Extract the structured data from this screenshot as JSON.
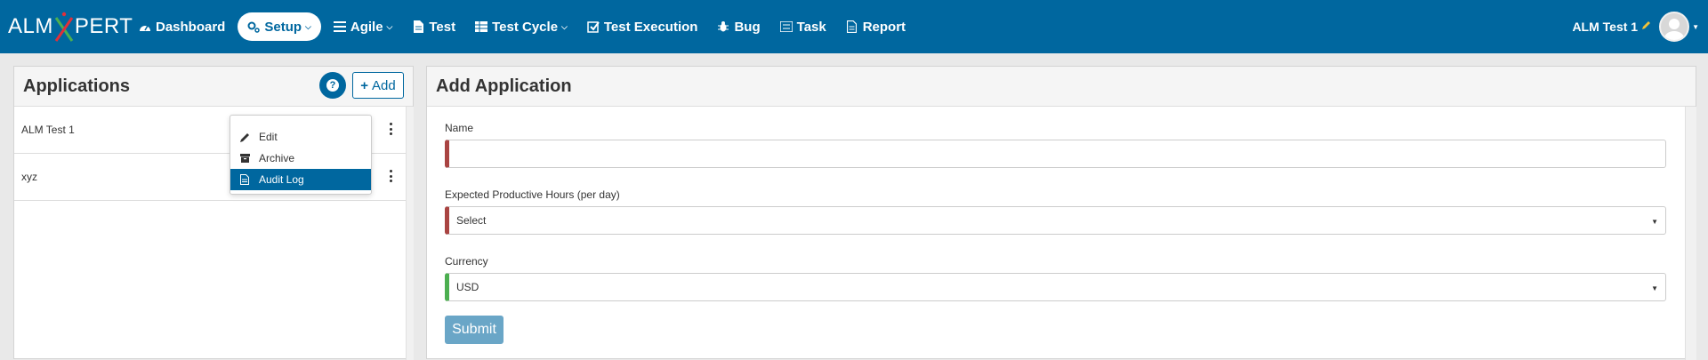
{
  "brand": {
    "logo_left": "ALM",
    "logo_right": "PERT"
  },
  "nav": {
    "items": [
      {
        "label": "Dashboard",
        "icon": "dashboard-icon"
      },
      {
        "label": "Setup",
        "icon": "cogs-icon",
        "active": true,
        "dropdown": true
      },
      {
        "label": "Agile",
        "icon": "list-icon",
        "dropdown": true
      },
      {
        "label": "Test",
        "icon": "file-icon"
      },
      {
        "label": "Test Cycle",
        "icon": "table-icon",
        "dropdown": true
      },
      {
        "label": "Test Execution",
        "icon": "check-square-icon"
      },
      {
        "label": "Bug",
        "icon": "bug-icon"
      },
      {
        "label": "Task",
        "icon": "tasks-icon"
      },
      {
        "label": "Report",
        "icon": "report-icon"
      }
    ],
    "user_name": "ALM Test 1"
  },
  "applications": {
    "title": "Applications",
    "add_label": "Add",
    "help_icon": "question-circle-icon",
    "items": [
      {
        "name": "ALM Test 1"
      },
      {
        "name": "xyz"
      }
    ],
    "menu": [
      {
        "label": "Edit",
        "icon": "pencil-icon"
      },
      {
        "label": "Archive",
        "icon": "archive-icon"
      },
      {
        "label": "Audit Log",
        "icon": "file-text-icon",
        "selected": true
      }
    ]
  },
  "form": {
    "title": "Add Application",
    "name_label": "Name",
    "name_value": "",
    "hours_label": "Expected Productive Hours (per day)",
    "hours_value": "Select",
    "currency_label": "Currency",
    "currency_value": "USD",
    "submit_label": "Submit"
  },
  "colors": {
    "primary": "#00679f",
    "required": "#a94442",
    "valid": "#4caf50",
    "selected_bg": "#00679f",
    "submit_bg": "#6aa6c7"
  }
}
